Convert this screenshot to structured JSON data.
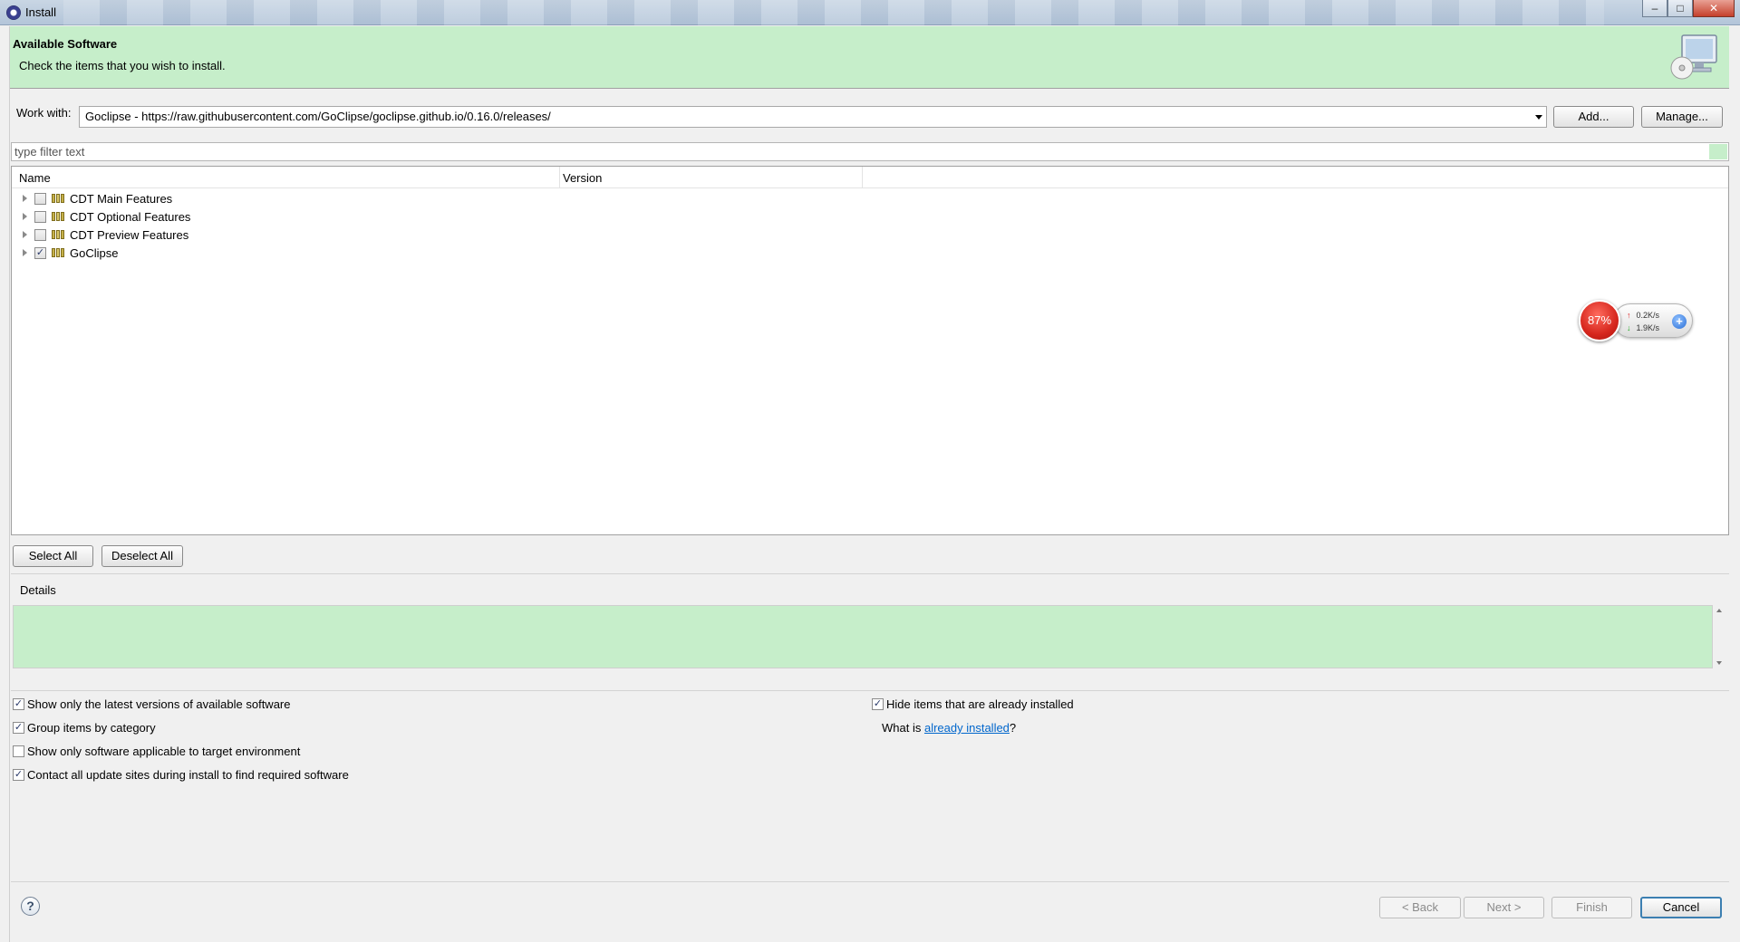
{
  "window": {
    "title": "Install",
    "minimize": "–",
    "maximize": "□",
    "close": "✕"
  },
  "banner": {
    "title": "Available Software",
    "subtitle": "Check the items that you wish to install."
  },
  "work_with": {
    "label": "Work with:",
    "value": "Goclipse - https://raw.githubusercontent.com/GoClipse/goclipse.github.io/0.16.0/releases/",
    "add_label": "Add...",
    "manage_label": "Manage..."
  },
  "filter": {
    "placeholder": "type filter text"
  },
  "tree": {
    "columns": [
      "Name",
      "Version"
    ],
    "items": [
      {
        "label": "CDT Main Features",
        "checked": false
      },
      {
        "label": "CDT Optional Features",
        "checked": false
      },
      {
        "label": "CDT Preview Features",
        "checked": false
      },
      {
        "label": "GoClipse",
        "checked": true
      }
    ]
  },
  "netmeter": {
    "percent": "87%",
    "up": "0.2K/s",
    "down": "1.9K/s",
    "up_arrow": "↑",
    "down_arrow": "↓",
    "plus": "+"
  },
  "selection_buttons": {
    "select_all": "Select All",
    "deselect_all": "Deselect All"
  },
  "details": {
    "label": "Details"
  },
  "options": {
    "latest_versions": {
      "label": "Show only the latest versions of available software",
      "checked": true
    },
    "group_by_category": {
      "label": "Group items by category",
      "checked": true
    },
    "applicable_only": {
      "label": "Show only software applicable to target environment",
      "checked": false
    },
    "contact_sites": {
      "label": "Contact all update sites during install to find required software",
      "checked": true
    },
    "hide_installed": {
      "label": "Hide items that are already installed",
      "checked": true
    },
    "what_is_prefix": "What is ",
    "what_is_link": "already installed",
    "what_is_suffix": "?"
  },
  "footer": {
    "help": "?",
    "back": "< Back",
    "next": "Next >",
    "finish": "Finish",
    "cancel": "Cancel"
  },
  "check_mark": "✓"
}
